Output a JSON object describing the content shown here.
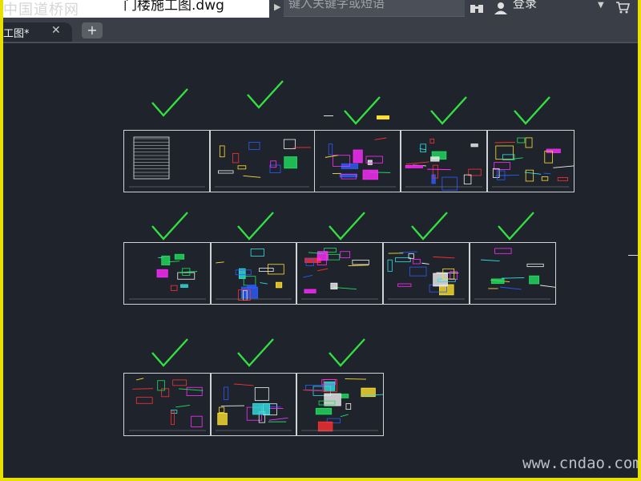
{
  "header": {
    "site_watermark": "中国道桥网",
    "file_name": "门楼施工图.dwg",
    "search_placeholder": "键入关键字或短语",
    "login_label": "登录"
  },
  "tabs": {
    "active_label": "工图*",
    "close_symbol": "✕",
    "add_symbol": "+"
  },
  "canvas": {
    "sheets_per_row": [
      5,
      5,
      3
    ],
    "check_color": "#33e040"
  },
  "footer": {
    "watermark": "www.cndao.com"
  }
}
